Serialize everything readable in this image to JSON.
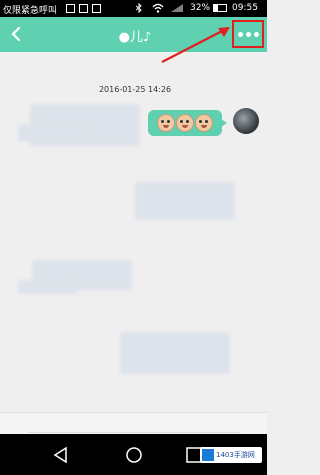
{
  "status_bar": {
    "carrier": "仅限紧急呼叫",
    "battery_percent": "32%",
    "battery_level": 0.32,
    "time": "09:55"
  },
  "header": {
    "title": "●儿♪",
    "back_icon": "chevron-left-icon",
    "more_icon": "more-horizontal-icon",
    "accent_color": "#5fd0b0",
    "highlight_color": "#e02020"
  },
  "chat": {
    "timestamp": "2016-01-25 14:26",
    "my_message": {
      "type": "sticker",
      "icons": [
        "face-icon",
        "face-icon",
        "face-icon"
      ]
    }
  },
  "watermark": {
    "text": "1403手游网"
  }
}
